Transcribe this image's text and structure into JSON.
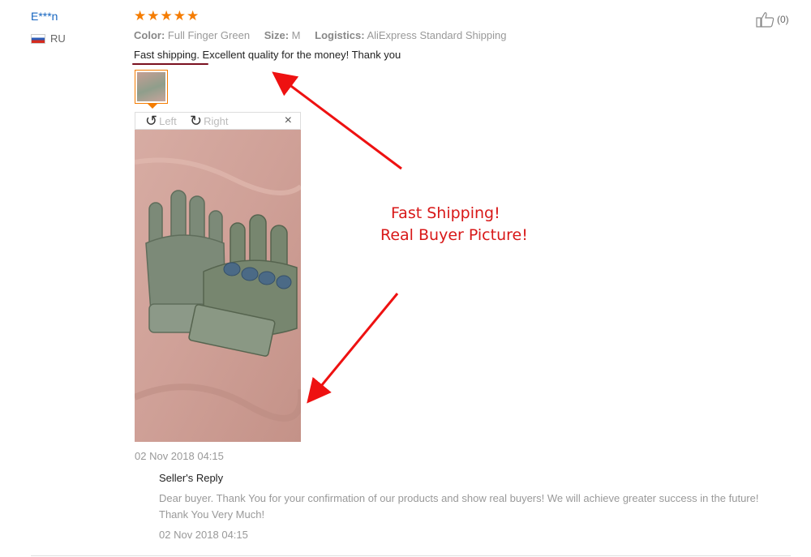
{
  "review": {
    "user_name": "E***n",
    "country": "RU",
    "rating_stars": 5,
    "like_count": "(0)",
    "labels": {
      "color": "Color:",
      "size": "Size:",
      "logistics": "Logistics:"
    },
    "color": "Full Finger Green",
    "size": "M",
    "logistics": "AliExpress Standard Shipping",
    "text": "Fast shipping. Excellent quality for the money! Thank you",
    "date": "02 Nov 2018 04:15"
  },
  "viewer": {
    "rotate_left": "Left",
    "rotate_right": "Right",
    "close": "×"
  },
  "reply": {
    "title": "Seller's Reply",
    "text": "Dear buyer. Thank You for your confirmation of our products and show real buyers! We will achieve greater success in the future! Thank You Very Much!",
    "date": "02 Nov 2018 04:15"
  },
  "annotation": {
    "line1": "Fast Shipping!",
    "line2": "Real Buyer Picture!",
    "color": "#d81818"
  },
  "colors": {
    "star": "#f57c00",
    "user": "#1565c0"
  },
  "icons": {
    "like": "thumbs-up-icon",
    "rotate_left": "rotate-left-icon",
    "rotate_right": "rotate-right-icon",
    "close": "close-icon"
  }
}
